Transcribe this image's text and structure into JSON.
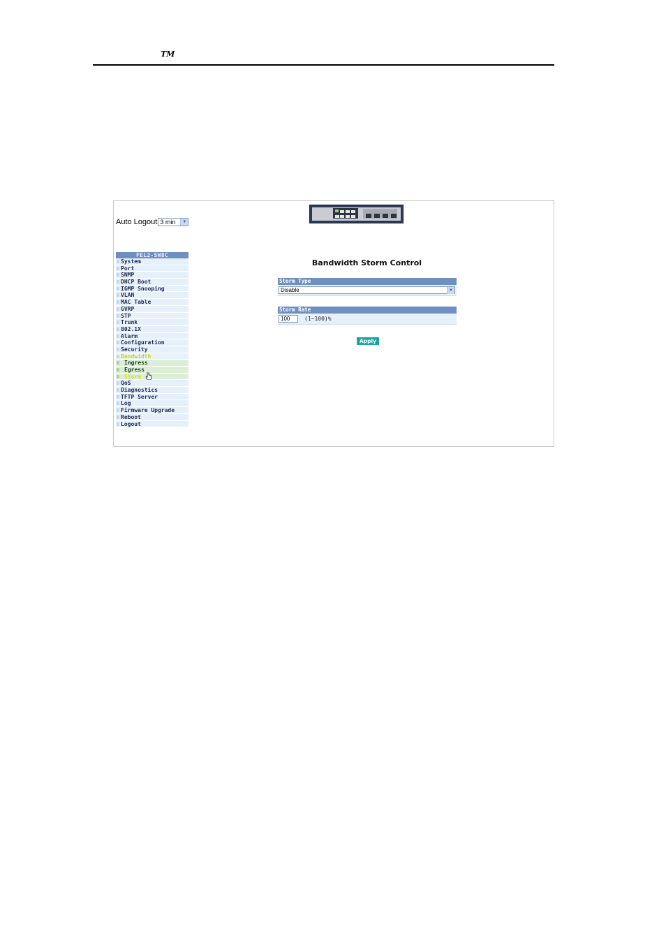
{
  "document": {
    "trademark": "TM"
  },
  "header": {
    "auto_logout_label": "Auto Logout",
    "auto_logout_value": "3 min"
  },
  "sidebar": {
    "title": "FEL2-SW8C",
    "items": [
      {
        "label": "System"
      },
      {
        "label": "Port"
      },
      {
        "label": "SNMP"
      },
      {
        "label": "DHCP Boot"
      },
      {
        "label": "IGMP Snooping"
      },
      {
        "label": "VLAN"
      },
      {
        "label": "MAC Table"
      },
      {
        "label": "GVRP"
      },
      {
        "label": "STP"
      },
      {
        "label": "Trunk"
      },
      {
        "label": "802.1X"
      },
      {
        "label": "Alarm"
      },
      {
        "label": "Configuration"
      },
      {
        "label": "Security"
      },
      {
        "label": "Bandwidth"
      },
      {
        "label": "Ingress"
      },
      {
        "label": "Egress"
      },
      {
        "label": "Storm"
      },
      {
        "label": "QoS"
      },
      {
        "label": "Diagnostics"
      },
      {
        "label": "TFTP Server"
      },
      {
        "label": "Log"
      },
      {
        "label": "Firmware Upgrade"
      },
      {
        "label": "Reboot"
      },
      {
        "label": "Logout"
      }
    ]
  },
  "main": {
    "title": "Bandwidth Storm Control",
    "storm_type": {
      "header": "Storm Type",
      "value": "Disable"
    },
    "storm_rate": {
      "header": "Storm Rate",
      "value": "100",
      "hint": "(1~100)%"
    },
    "apply_label": "Apply"
  },
  "colors": {
    "sidebar_header": "#6e8fbf",
    "sidebar_item_bg": "#e6f0fa",
    "submenu_bg": "#dcefd6",
    "active_text": "#cfd600",
    "apply_button": "#1aa5a5"
  },
  "icons": [
    "chevron-down-icon",
    "hand-cursor-icon",
    "switch-device-image"
  ]
}
